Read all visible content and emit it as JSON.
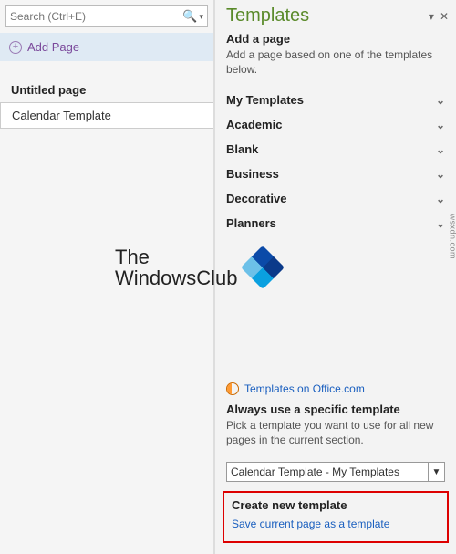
{
  "left": {
    "search_placeholder": "Search (Ctrl+E)",
    "add_page_label": "Add Page",
    "pages": [
      {
        "label": "Untitled page",
        "bold": true,
        "selected": false
      },
      {
        "label": "Calendar Template",
        "bold": false,
        "selected": true
      }
    ]
  },
  "pane": {
    "title": "Templates",
    "dropdown_glyph": "▾",
    "close_glyph": "✕"
  },
  "add_section": {
    "title": "Add a page",
    "desc": "Add a page based on one of the templates below."
  },
  "categories": [
    "My Templates",
    "Academic",
    "Blank",
    "Business",
    "Decorative",
    "Planners"
  ],
  "office_link": "Templates on Office.com",
  "always": {
    "title": "Always use a specific template",
    "desc": "Pick a template you want to use for all new pages in the current section.",
    "selected": "Calendar Template - My Templates"
  },
  "create": {
    "title": "Create new template",
    "link": "Save current page as a template"
  },
  "watermark": {
    "line1": "The",
    "line2": "WindowsClub"
  },
  "side_text": "wsxdn.com"
}
